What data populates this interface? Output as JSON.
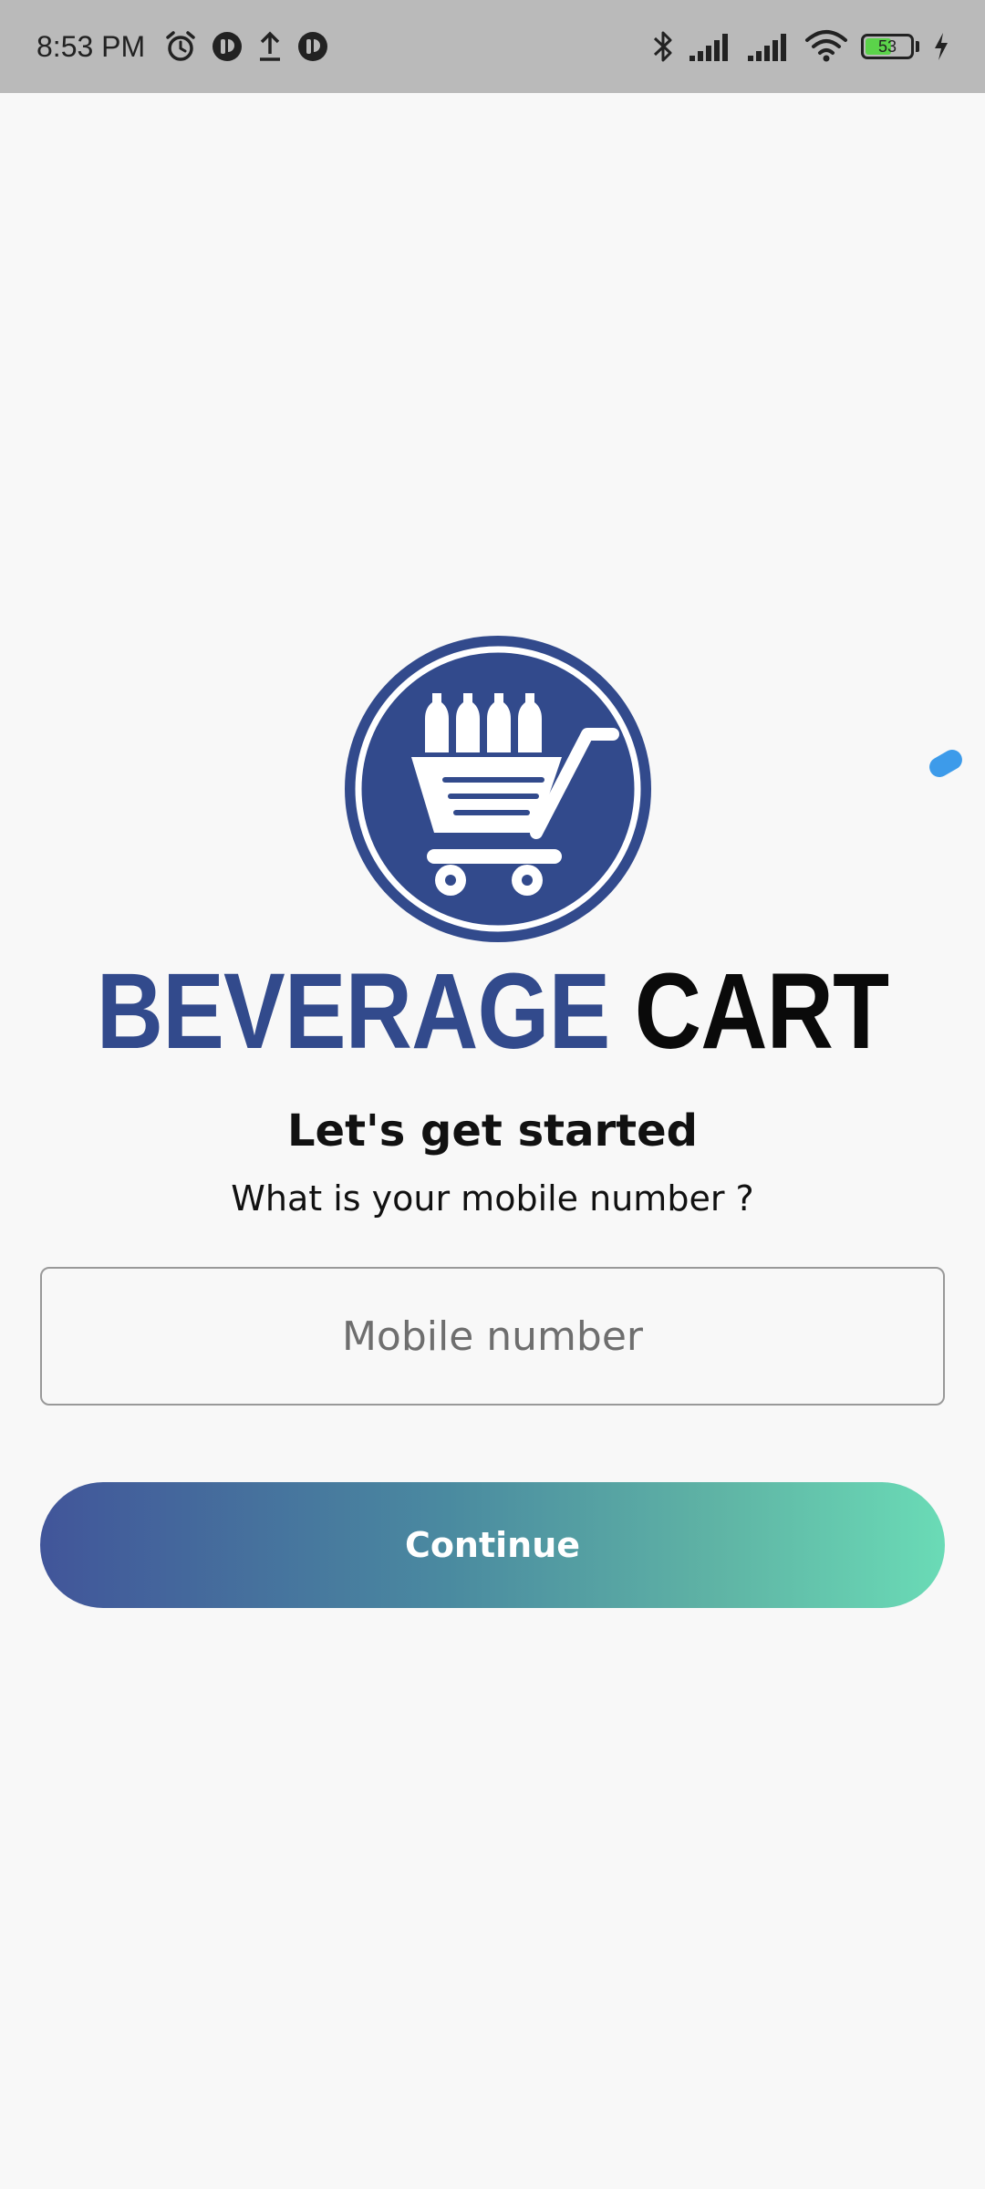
{
  "status_bar": {
    "time": "8:53 PM",
    "left_icons": [
      "alarm-icon",
      "app-notification-icon",
      "upload-icon",
      "app-notification-icon"
    ],
    "right_icons": [
      "bluetooth-icon",
      "signal-icon",
      "signal-icon",
      "wifi-icon",
      "battery-icon",
      "charging-icon"
    ],
    "battery_level": "53",
    "battery_fraction": 0.53
  },
  "logo": {
    "icon": "shopping-cart-with-bottles-icon",
    "word1": "BEVERAGE",
    "word2": "CART",
    "brand_color": "#324a8c",
    "secondary_color": "#0a0a0a"
  },
  "form": {
    "headline": "Let's get started",
    "subline": "What is your mobile number ?",
    "mobile_placeholder": "Mobile number",
    "mobile_value": "",
    "continue_label": "Continue"
  },
  "colors": {
    "background": "#f8f8f8",
    "status_bar": "#bababa",
    "button_gradient_start": "#41559a",
    "button_gradient_end": "#6adbb6",
    "floating_handle": "#3d9bea"
  }
}
